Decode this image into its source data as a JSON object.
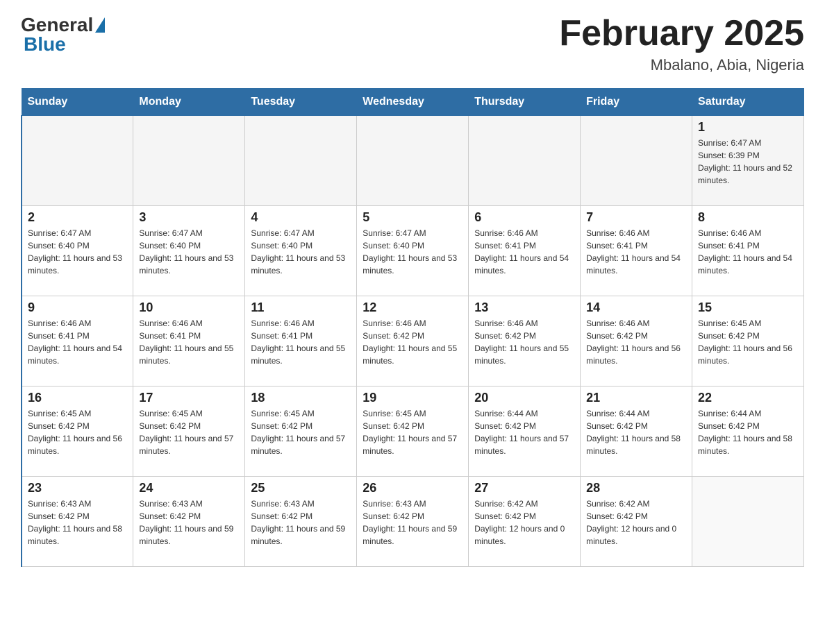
{
  "logo": {
    "general": "General",
    "blue": "Blue"
  },
  "header": {
    "title": "February 2025",
    "subtitle": "Mbalano, Abia, Nigeria"
  },
  "days_of_week": [
    "Sunday",
    "Monday",
    "Tuesday",
    "Wednesday",
    "Thursday",
    "Friday",
    "Saturday"
  ],
  "weeks": [
    [
      {
        "day": "",
        "sunrise": "",
        "sunset": "",
        "daylight": ""
      },
      {
        "day": "",
        "sunrise": "",
        "sunset": "",
        "daylight": ""
      },
      {
        "day": "",
        "sunrise": "",
        "sunset": "",
        "daylight": ""
      },
      {
        "day": "",
        "sunrise": "",
        "sunset": "",
        "daylight": ""
      },
      {
        "day": "",
        "sunrise": "",
        "sunset": "",
        "daylight": ""
      },
      {
        "day": "",
        "sunrise": "",
        "sunset": "",
        "daylight": ""
      },
      {
        "day": "1",
        "sunrise": "Sunrise: 6:47 AM",
        "sunset": "Sunset: 6:39 PM",
        "daylight": "Daylight: 11 hours and 52 minutes."
      }
    ],
    [
      {
        "day": "2",
        "sunrise": "Sunrise: 6:47 AM",
        "sunset": "Sunset: 6:40 PM",
        "daylight": "Daylight: 11 hours and 53 minutes."
      },
      {
        "day": "3",
        "sunrise": "Sunrise: 6:47 AM",
        "sunset": "Sunset: 6:40 PM",
        "daylight": "Daylight: 11 hours and 53 minutes."
      },
      {
        "day": "4",
        "sunrise": "Sunrise: 6:47 AM",
        "sunset": "Sunset: 6:40 PM",
        "daylight": "Daylight: 11 hours and 53 minutes."
      },
      {
        "day": "5",
        "sunrise": "Sunrise: 6:47 AM",
        "sunset": "Sunset: 6:40 PM",
        "daylight": "Daylight: 11 hours and 53 minutes."
      },
      {
        "day": "6",
        "sunrise": "Sunrise: 6:46 AM",
        "sunset": "Sunset: 6:41 PM",
        "daylight": "Daylight: 11 hours and 54 minutes."
      },
      {
        "day": "7",
        "sunrise": "Sunrise: 6:46 AM",
        "sunset": "Sunset: 6:41 PM",
        "daylight": "Daylight: 11 hours and 54 minutes."
      },
      {
        "day": "8",
        "sunrise": "Sunrise: 6:46 AM",
        "sunset": "Sunset: 6:41 PM",
        "daylight": "Daylight: 11 hours and 54 minutes."
      }
    ],
    [
      {
        "day": "9",
        "sunrise": "Sunrise: 6:46 AM",
        "sunset": "Sunset: 6:41 PM",
        "daylight": "Daylight: 11 hours and 54 minutes."
      },
      {
        "day": "10",
        "sunrise": "Sunrise: 6:46 AM",
        "sunset": "Sunset: 6:41 PM",
        "daylight": "Daylight: 11 hours and 55 minutes."
      },
      {
        "day": "11",
        "sunrise": "Sunrise: 6:46 AM",
        "sunset": "Sunset: 6:41 PM",
        "daylight": "Daylight: 11 hours and 55 minutes."
      },
      {
        "day": "12",
        "sunrise": "Sunrise: 6:46 AM",
        "sunset": "Sunset: 6:42 PM",
        "daylight": "Daylight: 11 hours and 55 minutes."
      },
      {
        "day": "13",
        "sunrise": "Sunrise: 6:46 AM",
        "sunset": "Sunset: 6:42 PM",
        "daylight": "Daylight: 11 hours and 55 minutes."
      },
      {
        "day": "14",
        "sunrise": "Sunrise: 6:46 AM",
        "sunset": "Sunset: 6:42 PM",
        "daylight": "Daylight: 11 hours and 56 minutes."
      },
      {
        "day": "15",
        "sunrise": "Sunrise: 6:45 AM",
        "sunset": "Sunset: 6:42 PM",
        "daylight": "Daylight: 11 hours and 56 minutes."
      }
    ],
    [
      {
        "day": "16",
        "sunrise": "Sunrise: 6:45 AM",
        "sunset": "Sunset: 6:42 PM",
        "daylight": "Daylight: 11 hours and 56 minutes."
      },
      {
        "day": "17",
        "sunrise": "Sunrise: 6:45 AM",
        "sunset": "Sunset: 6:42 PM",
        "daylight": "Daylight: 11 hours and 57 minutes."
      },
      {
        "day": "18",
        "sunrise": "Sunrise: 6:45 AM",
        "sunset": "Sunset: 6:42 PM",
        "daylight": "Daylight: 11 hours and 57 minutes."
      },
      {
        "day": "19",
        "sunrise": "Sunrise: 6:45 AM",
        "sunset": "Sunset: 6:42 PM",
        "daylight": "Daylight: 11 hours and 57 minutes."
      },
      {
        "day": "20",
        "sunrise": "Sunrise: 6:44 AM",
        "sunset": "Sunset: 6:42 PM",
        "daylight": "Daylight: 11 hours and 57 minutes."
      },
      {
        "day": "21",
        "sunrise": "Sunrise: 6:44 AM",
        "sunset": "Sunset: 6:42 PM",
        "daylight": "Daylight: 11 hours and 58 minutes."
      },
      {
        "day": "22",
        "sunrise": "Sunrise: 6:44 AM",
        "sunset": "Sunset: 6:42 PM",
        "daylight": "Daylight: 11 hours and 58 minutes."
      }
    ],
    [
      {
        "day": "23",
        "sunrise": "Sunrise: 6:43 AM",
        "sunset": "Sunset: 6:42 PM",
        "daylight": "Daylight: 11 hours and 58 minutes."
      },
      {
        "day": "24",
        "sunrise": "Sunrise: 6:43 AM",
        "sunset": "Sunset: 6:42 PM",
        "daylight": "Daylight: 11 hours and 59 minutes."
      },
      {
        "day": "25",
        "sunrise": "Sunrise: 6:43 AM",
        "sunset": "Sunset: 6:42 PM",
        "daylight": "Daylight: 11 hours and 59 minutes."
      },
      {
        "day": "26",
        "sunrise": "Sunrise: 6:43 AM",
        "sunset": "Sunset: 6:42 PM",
        "daylight": "Daylight: 11 hours and 59 minutes."
      },
      {
        "day": "27",
        "sunrise": "Sunrise: 6:42 AM",
        "sunset": "Sunset: 6:42 PM",
        "daylight": "Daylight: 12 hours and 0 minutes."
      },
      {
        "day": "28",
        "sunrise": "Sunrise: 6:42 AM",
        "sunset": "Sunset: 6:42 PM",
        "daylight": "Daylight: 12 hours and 0 minutes."
      },
      {
        "day": "",
        "sunrise": "",
        "sunset": "",
        "daylight": ""
      }
    ]
  ]
}
